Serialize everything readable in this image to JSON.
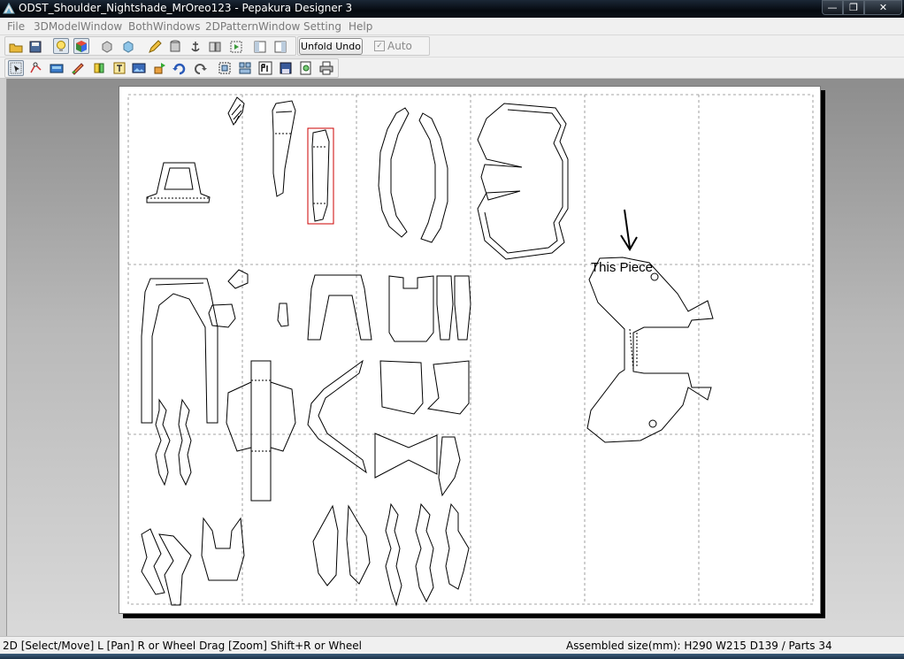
{
  "window": {
    "title": "ODST_Shoulder_Nightshade_MrOreo123 - Pepakura Designer 3",
    "minimize_symbol": "—",
    "maximize_symbol": "❐",
    "close_symbol": "✕"
  },
  "menu": [
    {
      "label": "File"
    },
    {
      "label": "3DModelWindow"
    },
    {
      "label": "BothWindows"
    },
    {
      "label": "2DPatternWindow"
    },
    {
      "label": "Setting"
    },
    {
      "label": "Help"
    }
  ],
  "toolbar1": {
    "icons": [
      "open-folder-icon",
      "save-icon",
      "lightbulb-icon",
      "color-cube-icon",
      "model-view-icon",
      "texture-icon",
      "pencil-icon",
      "cylinder-icon",
      "anchor-icon",
      "split-icon",
      "fold-icon",
      "window-left-icon",
      "window-right-icon"
    ],
    "unfold_undo_label": "Unfold Undo",
    "auto_label": "Auto",
    "auto_checked": true
  },
  "toolbar2": {
    "icons": [
      "select-arrow-icon",
      "edge-tool-icon",
      "flap-tool-icon",
      "paint-tool-icon",
      "join-icon",
      "text-icon",
      "image-icon",
      "move-parts-icon",
      "rotate-icon",
      "undo-icon",
      "arrange-icon",
      "layout-icon",
      "page-number-icon",
      "save-pattern-icon",
      "print-preview-icon",
      "print-icon"
    ]
  },
  "annotation": {
    "text": "This Piece"
  },
  "status": {
    "left": "2D [Select/Move] L [Pan] R or Wheel Drag [Zoom] Shift+R or Wheel",
    "right": "Assembled size(mm): H290 W215 D139 / Parts 34"
  },
  "colors": {
    "selection": "#cc0000",
    "outline": "#000000",
    "guide": "#888888"
  }
}
